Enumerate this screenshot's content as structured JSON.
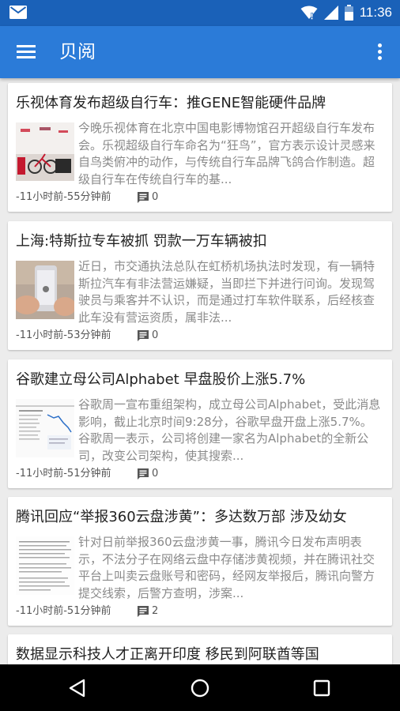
{
  "status_bar": {
    "time": "11:36",
    "icons": [
      "mail-icon",
      "wifi-icon",
      "cell-signal-icon",
      "battery-icon"
    ]
  },
  "app_bar": {
    "title": "贝阅",
    "menu_icon": "hamburger-menu-icon",
    "overflow_icon": "more-vert-icon",
    "color": "#2b7bd8"
  },
  "articles": [
    {
      "title": "乐视体育发布超级自行车：推GENE智能硬件品牌",
      "summary": "今晚乐视体育在北京中国电影博物馆召开超级自行车发布会。乐视超级自行车命名为“狂鸟”，官方表示设计灵感来自鸟类俯冲的动作，与传统自行车品牌飞鸽合作制造。超级自行车在传统自行车的基...",
      "time": "-11小时前-55分钟前",
      "comments": "0"
    },
    {
      "title": "上海:特斯拉专车被抓 罚款一万车辆被扣",
      "summary": "近日，市交通执法总队在虹桥机场执法时发现，有一辆特斯拉汽车有非法营运嫌疑，当即拦下并进行问询。发现驾驶员与乘客并不认识，而是通过打车软件联系，后经核查此车没有营运资质，属非法...",
      "time": "-11小时前-53分钟前",
      "comments": "0"
    },
    {
      "title": "谷歌建立母公司Alphabet 早盘股价上涨5.7%",
      "summary": "谷歌周一宣布重组架构，成立母公司Alphabet，受此消息影响，截止北京时间9:28分，谷歌早盘开盘上涨5.7%。谷歌周一表示，公司将创建一家名为Alphabet的全新公司，改变公司架构，使其搜索...",
      "time": "-11小时前-51分钟前",
      "comments": "0"
    },
    {
      "title": "腾讯回应“举报360云盘涉黄”：多达数万部 涉及幼女",
      "summary": "针对日前举报360云盘涉黄一事，腾讯今日发布声明表示，不法分子在网络云盘中存储涉黄视频，并在腾讯社交平台上叫卖云盘账号和密码，经网友举报后，腾讯向警方提交线索，后警方查明，涉案...",
      "time": "-11小时前-51分钟前",
      "comments": "2"
    },
    {
      "title": "数据显示科技人才正离开印度 移民到阿联酋等国"
    }
  ],
  "nav_bar": {
    "icons": [
      "back-icon",
      "home-icon",
      "recents-icon"
    ]
  }
}
